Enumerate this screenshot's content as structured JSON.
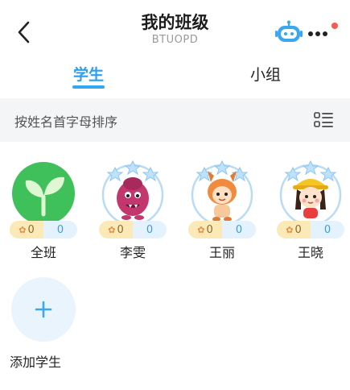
{
  "header": {
    "title": "我的班级",
    "class_code": "BTUOPD",
    "back_icon": "chevron-left",
    "robot_icon": "robot-assistant",
    "more_icon": "more-dots",
    "notification_dot_color": "#f55c4d"
  },
  "tabs": [
    {
      "label": "学生",
      "active": true
    },
    {
      "label": "小组",
      "active": false
    }
  ],
  "sort_bar": {
    "label": "按姓名首字母排序",
    "view_icon": "list-view-toggle"
  },
  "students": [
    {
      "name": "全班",
      "points_positive": "0",
      "points_negative": "0",
      "avatar": "sprout-green-circle"
    },
    {
      "name": "李雯",
      "points_positive": "0",
      "points_negative": "0",
      "avatar": "pink-monster"
    },
    {
      "name": "王丽",
      "points_positive": "0",
      "points_negative": "0",
      "avatar": "fox-deer-costume"
    },
    {
      "name": "王晓",
      "points_positive": "0",
      "points_negative": "0",
      "avatar": "girl-yellow-hat"
    }
  ],
  "add_student": {
    "label": "添加学生",
    "icon": "plus"
  },
  "colors": {
    "accent": "#2b9ff0",
    "positive_bg": "#fbe9b7",
    "negative_bg": "#e4f2fd"
  }
}
